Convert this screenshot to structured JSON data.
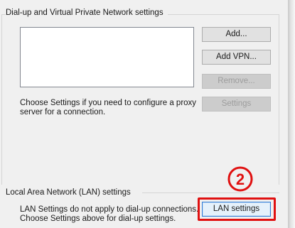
{
  "dialup": {
    "section_label": "Dial-up and Virtual Private Network settings",
    "buttons": {
      "add": "Add...",
      "add_vpn": "Add VPN...",
      "remove": "Remove...",
      "settings": "Settings"
    },
    "help_line1": "Choose Settings if you need to configure a proxy",
    "help_line2": "server for a connection."
  },
  "lan": {
    "section_label": "Local Area Network (LAN) settings",
    "help_line1": "LAN Settings do not apply to dial-up connections.",
    "help_line2": "Choose Settings above for dial-up settings.",
    "button_label": "LAN settings"
  },
  "annotation": {
    "step_number": "2",
    "color": "#e01010"
  }
}
